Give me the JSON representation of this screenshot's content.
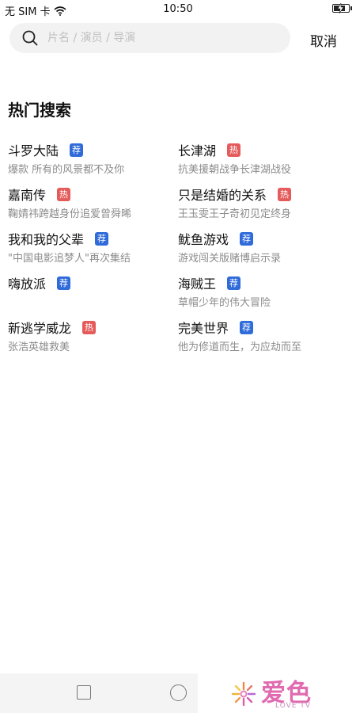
{
  "status_bar": {
    "carrier": "无 SIM 卡",
    "time": "10:50",
    "battery_level": 0.8
  },
  "search": {
    "placeholder": "片名 / 演员 / 导演",
    "value": "",
    "cancel_label": "取消"
  },
  "hot_search": {
    "title": "热门搜索",
    "items": [
      {
        "title": "斗罗大陆",
        "badge": "荐",
        "subtitle": "爆款 所有的风景都不及你"
      },
      {
        "title": "长津湖",
        "badge": "热",
        "subtitle": "抗美援朝战争长津湖战役"
      },
      {
        "title": "嘉南传",
        "badge": "热",
        "subtitle": "鞠婧祎跨越身份追爱曾舜晞"
      },
      {
        "title": "只是结婚的关系",
        "badge": "热",
        "subtitle": "王玉雯王子奇初见定终身"
      },
      {
        "title": "我和我的父辈",
        "badge": "荐",
        "subtitle": "\"中国电影追梦人\"再次集结"
      },
      {
        "title": "鱿鱼游戏",
        "badge": "荐",
        "subtitle": "游戏闯关版赌博启示录"
      },
      {
        "title": "嗨放派",
        "badge": "荐",
        "subtitle": ""
      },
      {
        "title": "海贼王",
        "badge": "荐",
        "subtitle": "草帽少年的伟大冒险"
      },
      {
        "title": "新逃学威龙",
        "badge": "热",
        "subtitle": "张浩英雄救美"
      },
      {
        "title": "完美世界",
        "badge": "荐",
        "subtitle": "他为修道而生，为应劫而至"
      }
    ]
  },
  "watermark": {
    "text": "爱色",
    "subtext": "LOVE TV"
  },
  "colors": {
    "badge_recommend": "#2f6bd9",
    "badge_hot": "#e55a5a",
    "subtitle": "#8c8c8c"
  },
  "icons": {
    "search": "magnifier-icon",
    "back": "square-icon",
    "home": "circle-icon"
  }
}
